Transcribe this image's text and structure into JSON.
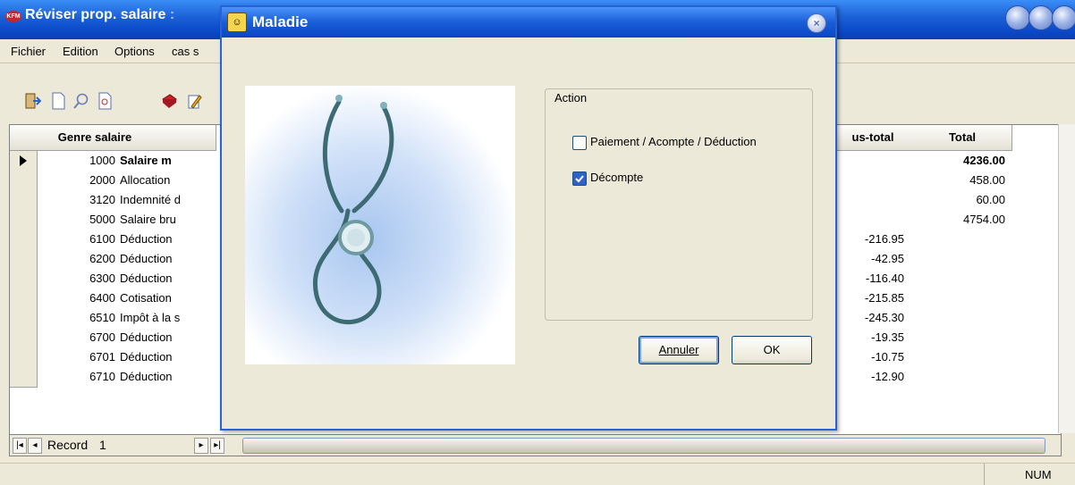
{
  "main": {
    "app_logo": "KFM",
    "title": "Réviser prop. salaire",
    "title_suffix": ":"
  },
  "menu": [
    "Fichier",
    "Edition",
    "Options",
    "cas s"
  ],
  "grid": {
    "headers": {
      "genre": "Genre salaire",
      "subtotal": "us-total",
      "total": "Total"
    },
    "rows": [
      {
        "code": "1000",
        "label": "Salaire m",
        "subtotal": "",
        "total": "4236.00",
        "bold": true
      },
      {
        "code": "2000",
        "label": "Allocation",
        "subtotal": "",
        "total": "458.00"
      },
      {
        "code": "3120",
        "label": "Indemnité d",
        "subtotal": "",
        "total": "60.00"
      },
      {
        "code": "5000",
        "label": "Salaire bru",
        "subtotal": "",
        "total": "4754.00"
      },
      {
        "code": "6100",
        "label": "Déduction",
        "subtotal": "-216.95",
        "total": ""
      },
      {
        "code": "6200",
        "label": "Déduction",
        "subtotal": "-42.95",
        "total": ""
      },
      {
        "code": "6300",
        "label": "Déduction",
        "subtotal": "-116.40",
        "total": ""
      },
      {
        "code": "6400",
        "label": "Cotisation",
        "subtotal": "-215.85",
        "total": ""
      },
      {
        "code": "6510",
        "label": "Impôt à la s",
        "subtotal": "-245.30",
        "total": ""
      },
      {
        "code": "6700",
        "label": "Déduction",
        "subtotal": "-19.35",
        "total": ""
      },
      {
        "code": "6701",
        "label": "Déduction",
        "subtotal": "-10.75",
        "total": ""
      },
      {
        "code": "6710",
        "label": "Déduction",
        "subtotal": "-12.90",
        "total": ""
      }
    ]
  },
  "nav": {
    "record_label": "Record",
    "record_value": "1"
  },
  "status": {
    "num": "NUM"
  },
  "dialog": {
    "title": "Maladie",
    "group_label": "Action",
    "options": [
      {
        "label": "Paiement / Acompte / Déduction",
        "checked": false
      },
      {
        "label": "Décompte",
        "checked": true
      }
    ],
    "cancel_label": "Annuler",
    "ok_label": "OK"
  }
}
